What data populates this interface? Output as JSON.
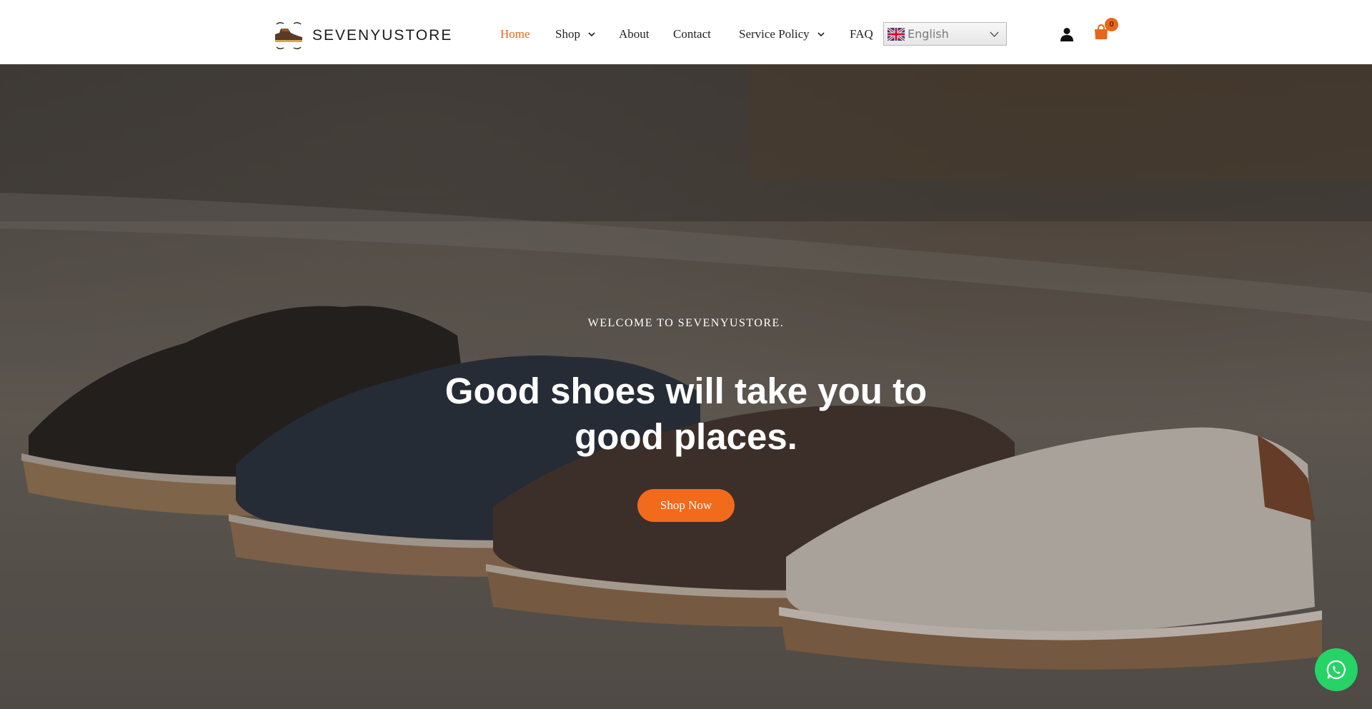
{
  "brand": {
    "name": "SEVENYUSTORE"
  },
  "nav": {
    "items": [
      {
        "label": "Home",
        "active": true
      },
      {
        "label": "Shop",
        "has_dropdown": true
      },
      {
        "label": "About"
      },
      {
        "label": "Contact"
      },
      {
        "label": "Service Policy",
        "has_dropdown": true
      },
      {
        "label": "FAQ"
      }
    ]
  },
  "language": {
    "selected": "English",
    "flag": "uk-flag-icon"
  },
  "header_icons": {
    "user": "user-icon",
    "cart": "cart-icon",
    "cart_count": "0"
  },
  "hero": {
    "eyebrow": "WELCOME TO SEVENYUSTORE.",
    "title": "Good shoes will take you to good places.",
    "cta_label": "Shop Now"
  },
  "floating": {
    "whatsapp": "whatsapp-icon"
  },
  "colors": {
    "accent": "#e8661c",
    "button": "#f26a1b",
    "whatsapp": "#25d366",
    "header_bg": "#ffffff"
  }
}
